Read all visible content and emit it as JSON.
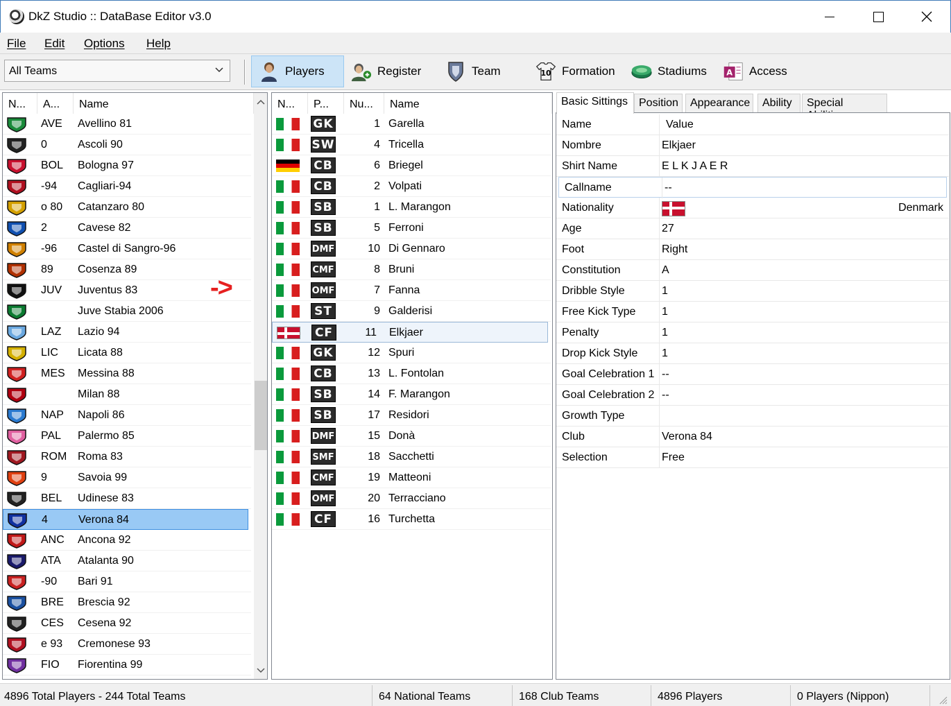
{
  "window": {
    "title": "DkZ Studio :: DataBase Editor v3.0"
  },
  "menu": [
    "File",
    "Edit",
    "Options",
    "Help"
  ],
  "toolbar": {
    "team_filter": "All Teams",
    "buttons": [
      "Players",
      "Register",
      "Team",
      "Formation",
      "Stadiums",
      "Access"
    ]
  },
  "teams_list": {
    "headers": [
      "N...",
      "A...",
      "Name"
    ],
    "rows": [
      {
        "abbr": "AVE",
        "name": "Avellino 81",
        "crest": "#1a8a3a"
      },
      {
        "abbr": "0",
        "name": "Ascoli 90",
        "crest": "#222222"
      },
      {
        "abbr": "BOL",
        "name": "Bologna 97",
        "crest": "#c8102e"
      },
      {
        "abbr": "-94",
        "name": "Cagliari-94",
        "crest": "#b01020"
      },
      {
        "abbr": "o 80",
        "name": "Catanzaro 80",
        "crest": "#d4a000"
      },
      {
        "abbr": "2",
        "name": "Cavese 82",
        "crest": "#1050b0"
      },
      {
        "abbr": "-96",
        "name": "Castel di Sangro-96",
        "crest": "#d08000"
      },
      {
        "abbr": "89",
        "name": "Cosenza 89",
        "crest": "#b03000"
      },
      {
        "abbr": "JUV",
        "name": "Juventus 83",
        "crest": "#111111"
      },
      {
        "abbr": "",
        "name": "Juve Stabia 2006",
        "crest": "#0a7a30"
      },
      {
        "abbr": "LAZ",
        "name": "Lazio 94",
        "crest": "#6aa8e0"
      },
      {
        "abbr": "LIC",
        "name": "Licata 88",
        "crest": "#d4b000"
      },
      {
        "abbr": "MES",
        "name": "Messina 88",
        "crest": "#d02020"
      },
      {
        "abbr": "",
        "name": "Milan 88",
        "crest": "#b00010"
      },
      {
        "abbr": "NAP",
        "name": "Napoli 86",
        "crest": "#2a7ad0"
      },
      {
        "abbr": "PAL",
        "name": "Palermo 85",
        "crest": "#e060a0"
      },
      {
        "abbr": "ROM",
        "name": "Roma 83",
        "crest": "#a01820"
      },
      {
        "abbr": "9",
        "name": "Savoia 99",
        "crest": "#e04010"
      },
      {
        "abbr": "BEL",
        "name": "Udinese 83",
        "crest": "#222222"
      },
      {
        "abbr": "4",
        "name": "Verona 84",
        "crest": "#1030a0"
      },
      {
        "abbr": "ANC",
        "name": "Ancona 92",
        "crest": "#c01818"
      },
      {
        "abbr": "ATA",
        "name": "Atalanta 90",
        "crest": "#1a1a6a"
      },
      {
        "abbr": "-90",
        "name": "Bari 91",
        "crest": "#c82020"
      },
      {
        "abbr": "BRE",
        "name": "Brescia 92",
        "crest": "#1a50a0"
      },
      {
        "abbr": "CES",
        "name": "Cesena 92",
        "crest": "#222222"
      },
      {
        "abbr": "e 93",
        "name": "Cremonese 93",
        "crest": "#b01020"
      },
      {
        "abbr": "FIO",
        "name": "Fiorentina 99",
        "crest": "#7030a0"
      }
    ],
    "selected_name": "Verona 84"
  },
  "annotation_arrow": "->",
  "players_list": {
    "headers": [
      "N...",
      "P...",
      "Nu...",
      "Name"
    ],
    "rows": [
      {
        "flag": "it",
        "pos": "GK",
        "num": "1",
        "name": "Garella"
      },
      {
        "flag": "it",
        "pos": "SW",
        "num": "4",
        "name": "Tricella"
      },
      {
        "flag": "de",
        "pos": "CB",
        "num": "6",
        "name": "Briegel"
      },
      {
        "flag": "it",
        "pos": "CB",
        "num": "2",
        "name": "Volpati"
      },
      {
        "flag": "it",
        "pos": "SB",
        "num": "1",
        "name": "L. Marangon"
      },
      {
        "flag": "it",
        "pos": "SB",
        "num": "5",
        "name": "Ferroni"
      },
      {
        "flag": "it",
        "pos": "DMF",
        "num": "10",
        "name": "Di Gennaro"
      },
      {
        "flag": "it",
        "pos": "CMF",
        "num": "8",
        "name": "Bruni"
      },
      {
        "flag": "it",
        "pos": "OMF",
        "num": "7",
        "name": "Fanna"
      },
      {
        "flag": "it",
        "pos": "ST",
        "num": "9",
        "name": "Galderisi"
      },
      {
        "flag": "dk",
        "pos": "CF",
        "num": "11",
        "name": "Elkjaer"
      },
      {
        "flag": "it",
        "pos": "GK",
        "num": "12",
        "name": "Spuri"
      },
      {
        "flag": "it",
        "pos": "CB",
        "num": "13",
        "name": "L. Fontolan"
      },
      {
        "flag": "it",
        "pos": "SB",
        "num": "14",
        "name": "F. Marangon"
      },
      {
        "flag": "it",
        "pos": "SB",
        "num": "17",
        "name": "Residori"
      },
      {
        "flag": "it",
        "pos": "DMF",
        "num": "15",
        "name": "Donà"
      },
      {
        "flag": "it",
        "pos": "SMF",
        "num": "18",
        "name": "Sacchetti"
      },
      {
        "flag": "it",
        "pos": "CMF",
        "num": "19",
        "name": "Matteoni"
      },
      {
        "flag": "it",
        "pos": "OMF",
        "num": "20",
        "name": "Terracciano"
      },
      {
        "flag": "it",
        "pos": "CF",
        "num": "16",
        "name": "Turchetta"
      }
    ],
    "selected_name": "Elkjaer"
  },
  "tabs": [
    "Basic Sittings",
    "Position",
    "Appearance",
    "Ability",
    "Special Abilities"
  ],
  "properties": {
    "header": {
      "key": "Name",
      "value": "Value"
    },
    "rows": [
      {
        "key": "Nombre",
        "value": "Elkjaer"
      },
      {
        "key": "Shirt Name",
        "value": "E L K J A E R"
      },
      {
        "key": "Callname",
        "value": "--"
      },
      {
        "key": "Nationality",
        "value": "Denmark"
      },
      {
        "key": "Age",
        "value": "27"
      },
      {
        "key": "Foot",
        "value": "Right"
      },
      {
        "key": "Constitution",
        "value": "A"
      },
      {
        "key": "Dribble Style",
        "value": "1"
      },
      {
        "key": "Free Kick Type",
        "value": "1"
      },
      {
        "key": "Penalty",
        "value": "1"
      },
      {
        "key": "Drop Kick Style",
        "value": "1"
      },
      {
        "key": "Goal Celebration 1",
        "value": "--"
      },
      {
        "key": "Goal Celebration 2",
        "value": "--"
      },
      {
        "key": "Growth Type",
        "value": ""
      },
      {
        "key": "Club",
        "value": "Verona 84"
      },
      {
        "key": "Selection",
        "value": "Free"
      }
    ]
  },
  "status": [
    "4896 Total Players  -  244 Total Teams",
    "64 National Teams",
    "168 Club Teams",
    "4896 Players",
    "0 Players (Nippon)"
  ]
}
